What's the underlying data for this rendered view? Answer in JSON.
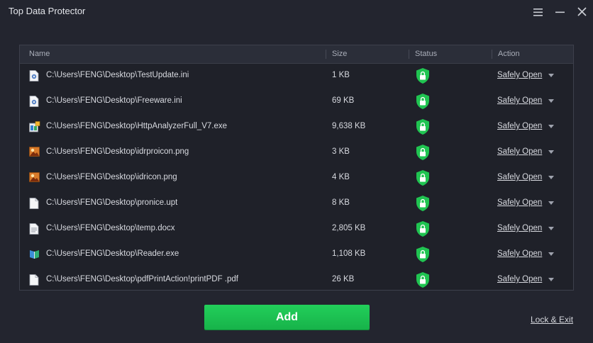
{
  "app": {
    "title": "Top Data Protector"
  },
  "table": {
    "headers": {
      "name": "Name",
      "size": "Size",
      "status": "Status",
      "action": "Action"
    },
    "rows": [
      {
        "icon": "ini-file-icon",
        "name": "C:\\Users\\FENG\\Desktop\\TestUpdate.ini",
        "size": "1 KB",
        "status": "protected-shield-icon",
        "action": "Safely Open"
      },
      {
        "icon": "ini-file-icon",
        "name": "C:\\Users\\FENG\\Desktop\\Freeware.ini",
        "size": "69 KB",
        "status": "protected-shield-icon",
        "action": "Safely Open"
      },
      {
        "icon": "exe-app-icon",
        "name": "C:\\Users\\FENG\\Desktop\\HttpAnalyzerFull_V7.exe",
        "size": "9,638 KB",
        "status": "protected-shield-icon",
        "action": "Safely Open"
      },
      {
        "icon": "png-image-icon",
        "name": "C:\\Users\\FENG\\Desktop\\idrproicon.png",
        "size": "3 KB",
        "status": "protected-shield-icon",
        "action": "Safely Open"
      },
      {
        "icon": "png-image-icon",
        "name": "C:\\Users\\FENG\\Desktop\\idricon.png",
        "size": "4 KB",
        "status": "protected-shield-icon",
        "action": "Safely Open"
      },
      {
        "icon": "blank-file-icon",
        "name": "C:\\Users\\FENG\\Desktop\\pronice.upt",
        "size": "8 KB",
        "status": "protected-shield-icon",
        "action": "Safely Open"
      },
      {
        "icon": "document-file-icon",
        "name": "C:\\Users\\FENG\\Desktop\\temp.docx",
        "size": "2,805 KB",
        "status": "protected-shield-icon",
        "action": "Safely Open"
      },
      {
        "icon": "book-app-icon",
        "name": "C:\\Users\\FENG\\Desktop\\Reader.exe",
        "size": "1,108 KB",
        "status": "protected-shield-icon",
        "action": "Safely Open"
      },
      {
        "icon": "blank-file-icon",
        "name": "C:\\Users\\FENG\\Desktop\\pdfPrintAction!printPDF .pdf",
        "size": "26 KB",
        "status": "protected-shield-icon",
        "action": "Safely Open"
      }
    ]
  },
  "footer": {
    "add_label": "Add",
    "lock_exit_label": "Lock & Exit"
  },
  "colors": {
    "background": "#23252f",
    "accent_green": "#1fc654",
    "shield_green": "#20c451"
  }
}
